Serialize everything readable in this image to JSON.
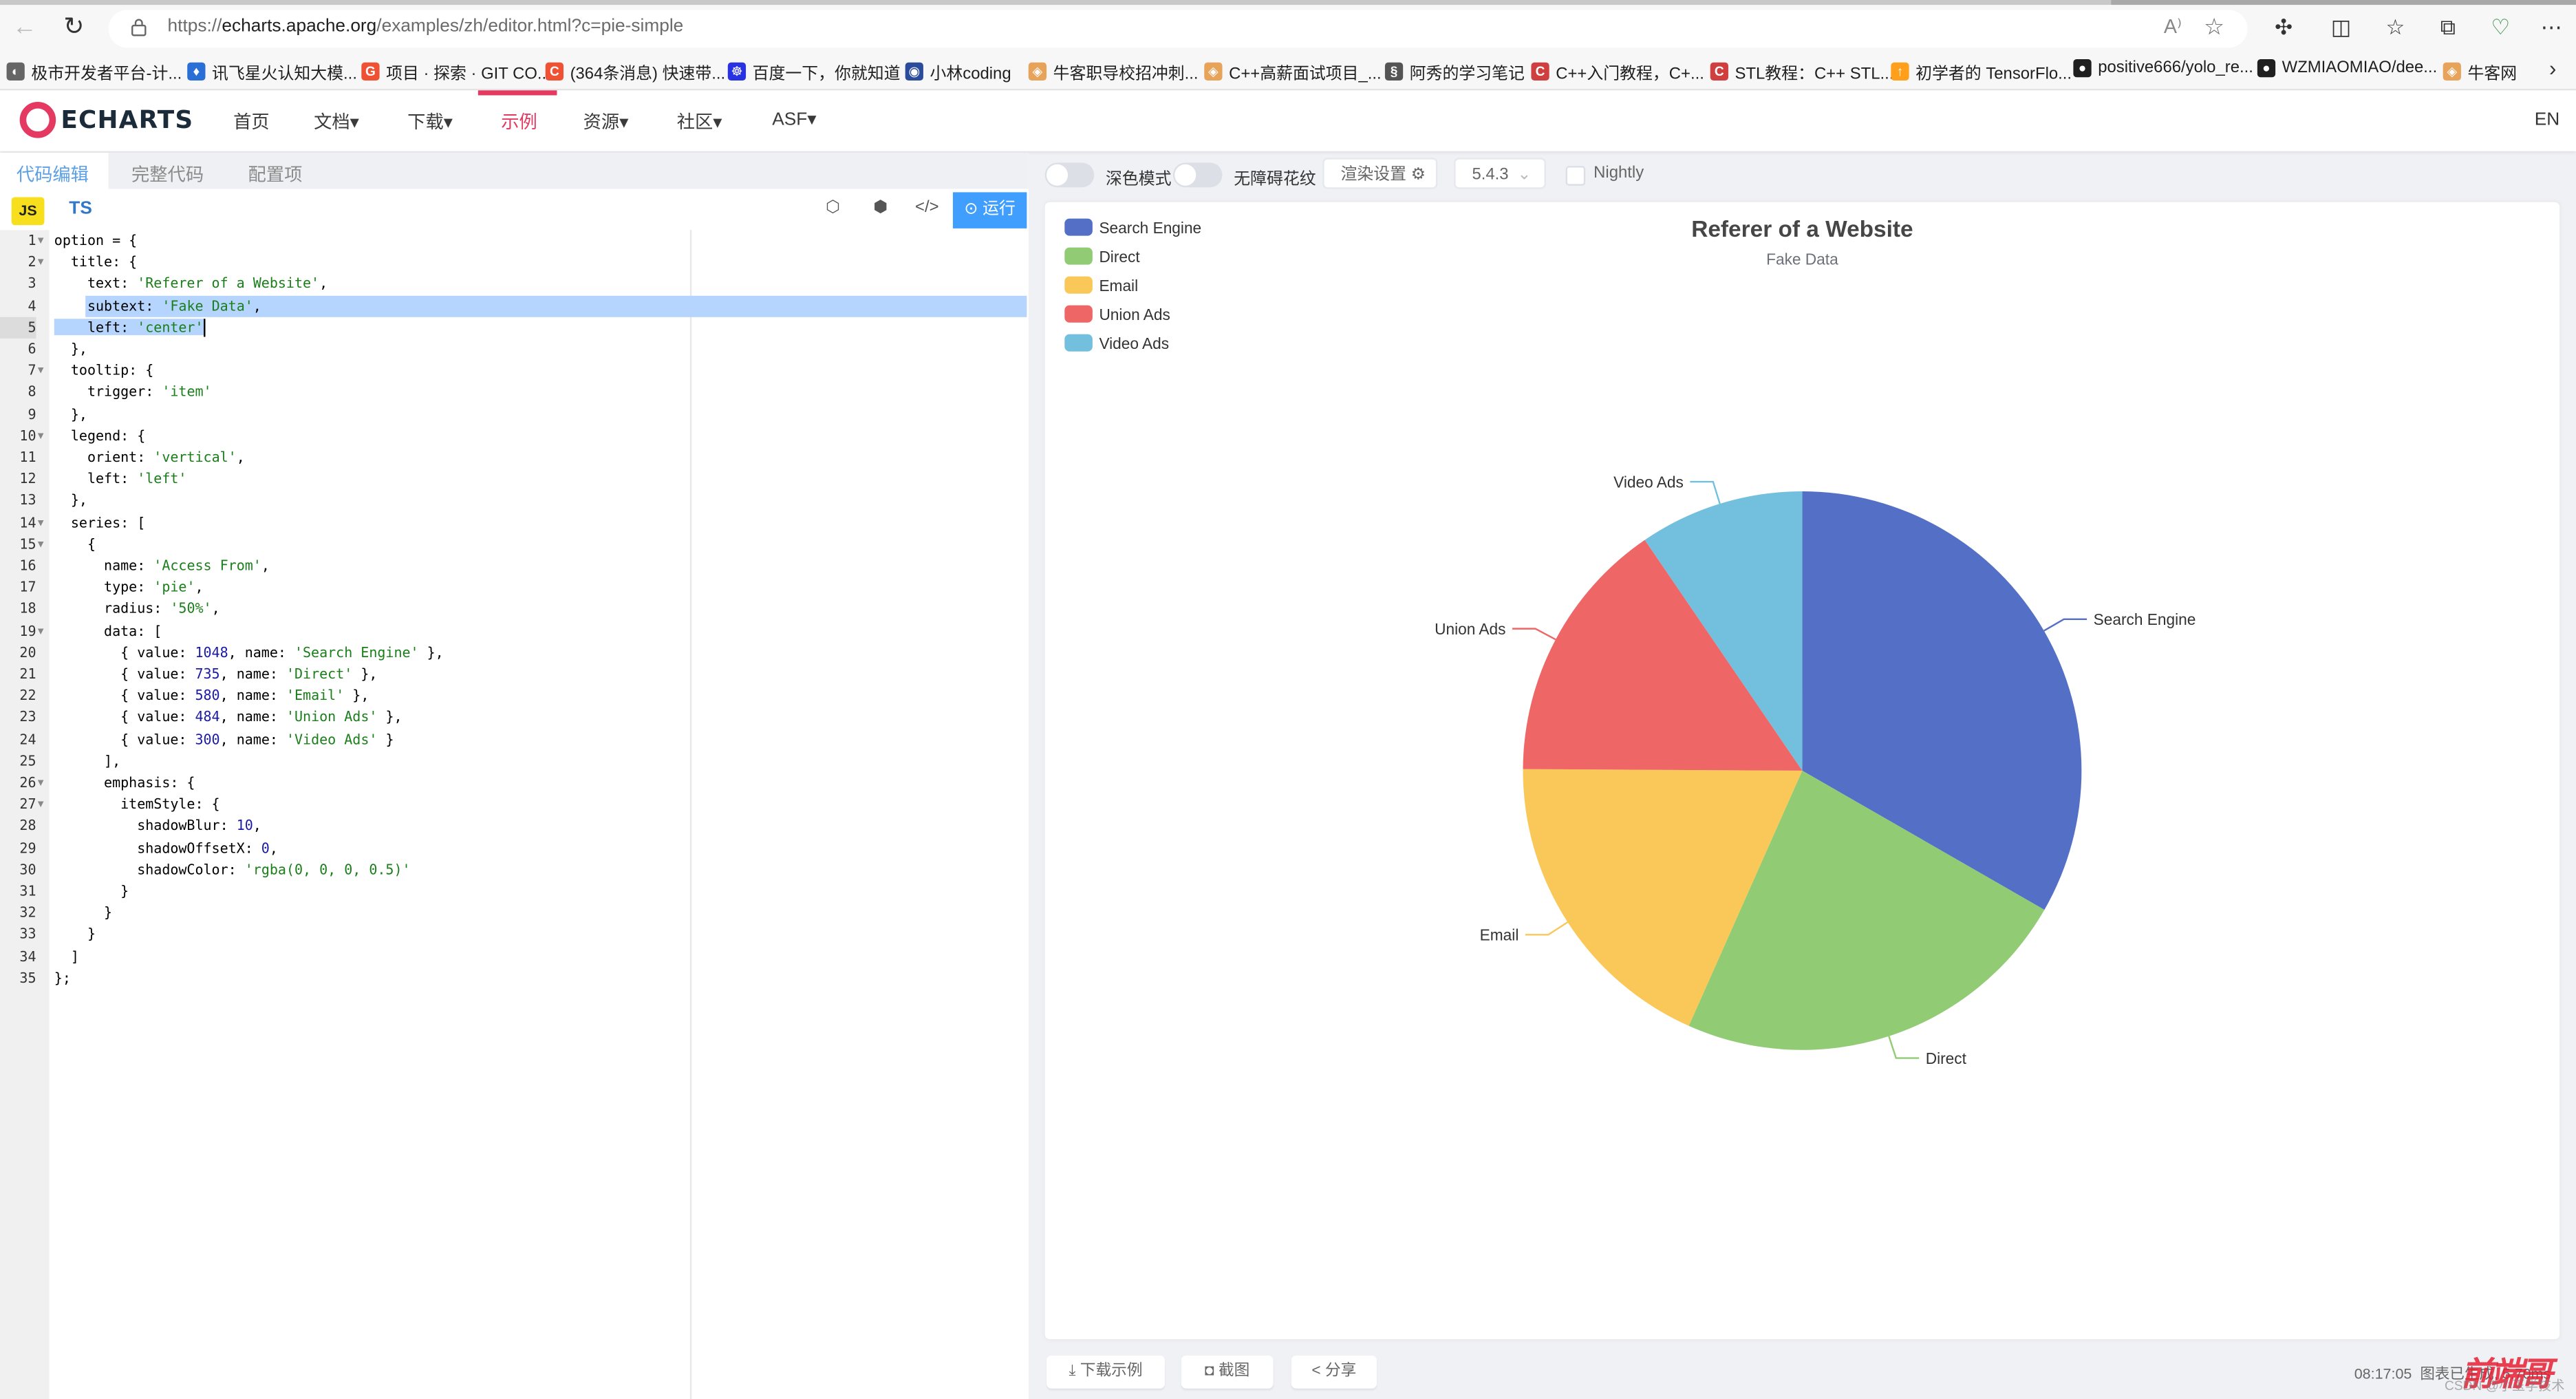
{
  "browser": {
    "url_prefix": "https://",
    "url_domain": "echarts.apache.org",
    "url_path": "/examples/zh/editor.html?c=pie-simple",
    "read_aloud_icon": "A⁾",
    "bookmarks": [
      {
        "label": "极市开发者平台-计...",
        "icon_color": "#666666",
        "icon_char": "◐"
      },
      {
        "label": "讯飞星火认知大模...",
        "icon_color": "#2a6fd6",
        "icon_char": "♦"
      },
      {
        "label": "项目 · 探索 · GIT CO...",
        "icon_color": "#f05133",
        "icon_char": "G"
      },
      {
        "label": "(364条消息) 快速带...",
        "icon_color": "#f05133",
        "icon_char": "C"
      },
      {
        "label": "百度一下，你就知道",
        "icon_color": "#2932e1",
        "icon_char": "☸"
      },
      {
        "label": "小林coding",
        "icon_color": "#2b4c9b",
        "icon_char": "◉"
      },
      {
        "label": "牛客职导校招冲刺...",
        "icon_color": "#e8a35a",
        "icon_char": "◈"
      },
      {
        "label": "C++高薪面试项目_...",
        "icon_color": "#e8a35a",
        "icon_char": "◈"
      },
      {
        "label": "阿秀的学习笔记",
        "icon_color": "#555555",
        "icon_char": "§"
      },
      {
        "label": "C++入门教程，C+...",
        "icon_color": "#d03f3f",
        "icon_char": "C"
      },
      {
        "label": "STL教程：C++ STL...",
        "icon_color": "#d03f3f",
        "icon_char": "C"
      },
      {
        "label": "初学者的 TensorFlo...",
        "icon_color": "#ff9f1c",
        "icon_char": "↑"
      },
      {
        "label": "positive666/yolo_re...",
        "icon_color": "#1f1f1f",
        "icon_char": "●"
      },
      {
        "label": "WZMIAOMIAO/dee...",
        "icon_color": "#1f1f1f",
        "icon_char": "●"
      },
      {
        "label": "牛客网",
        "icon_color": "#e8a35a",
        "icon_char": "◈"
      }
    ]
  },
  "site": {
    "logo_text": "ECHARTS",
    "menu": [
      {
        "label": "首页",
        "active": false
      },
      {
        "label": "文档▾",
        "active": false
      },
      {
        "label": "下载▾",
        "active": false
      },
      {
        "label": "示例",
        "active": true
      },
      {
        "label": "资源▾",
        "active": false
      },
      {
        "label": "社区▾",
        "active": false
      },
      {
        "label": "ASF▾",
        "active": false
      }
    ],
    "lang_switch": "EN"
  },
  "editor": {
    "tabs": [
      {
        "label": "代码编辑",
        "active": true
      },
      {
        "label": "完整代码",
        "active": false
      },
      {
        "label": "配置项",
        "active": false
      }
    ],
    "lang_js": "JS",
    "lang_ts": "TS",
    "run_label": "运行",
    "lines": [
      {
        "n": "1",
        "fold": true,
        "html": "option = {"
      },
      {
        "n": "2",
        "fold": true,
        "html": "  title: {"
      },
      {
        "n": "3",
        "fold": false,
        "html": "    text: <span class='s'>'Referer of a Website'</span>,"
      },
      {
        "n": "4",
        "fold": false,
        "html": "    <span class='sel'>subtext: <span class='s'>'Fake Data'</span>,</span>",
        "sel_full": true
      },
      {
        "n": "5",
        "fold": false,
        "html": "<span class='sel'>    left: <span class='s'>'center'</span></span><span class='cursor'></span>",
        "current": true
      },
      {
        "n": "6",
        "fold": false,
        "html": "  },"
      },
      {
        "n": "7",
        "fold": true,
        "html": "  tooltip: {"
      },
      {
        "n": "8",
        "fold": false,
        "html": "    trigger: <span class='s'>'item'</span>"
      },
      {
        "n": "9",
        "fold": false,
        "html": "  },"
      },
      {
        "n": "10",
        "fold": true,
        "html": "  legend: {"
      },
      {
        "n": "11",
        "fold": false,
        "html": "    orient: <span class='s'>'vertical'</span>,"
      },
      {
        "n": "12",
        "fold": false,
        "html": "    left: <span class='s'>'left'</span>"
      },
      {
        "n": "13",
        "fold": false,
        "html": "  },"
      },
      {
        "n": "14",
        "fold": true,
        "html": "  series: ["
      },
      {
        "n": "15",
        "fold": true,
        "html": "    {"
      },
      {
        "n": "16",
        "fold": false,
        "html": "      name: <span class='s'>'Access From'</span>,"
      },
      {
        "n": "17",
        "fold": false,
        "html": "      type: <span class='s'>'pie'</span>,"
      },
      {
        "n": "18",
        "fold": false,
        "html": "      radius: <span class='s'>'50%'</span>,"
      },
      {
        "n": "19",
        "fold": true,
        "html": "      data: ["
      },
      {
        "n": "20",
        "fold": false,
        "html": "        { value: <span class='n'>1048</span>, name: <span class='s'>'Search Engine'</span> },"
      },
      {
        "n": "21",
        "fold": false,
        "html": "        { value: <span class='n'>735</span>, name: <span class='s'>'Direct'</span> },"
      },
      {
        "n": "22",
        "fold": false,
        "html": "        { value: <span class='n'>580</span>, name: <span class='s'>'Email'</span> },"
      },
      {
        "n": "23",
        "fold": false,
        "html": "        { value: <span class='n'>484</span>, name: <span class='s'>'Union Ads'</span> },"
      },
      {
        "n": "24",
        "fold": false,
        "html": "        { value: <span class='n'>300</span>, name: <span class='s'>'Video Ads'</span> }"
      },
      {
        "n": "25",
        "fold": false,
        "html": "      ],"
      },
      {
        "n": "26",
        "fold": true,
        "html": "      emphasis: {"
      },
      {
        "n": "27",
        "fold": true,
        "html": "        itemStyle: {"
      },
      {
        "n": "28",
        "fold": false,
        "html": "          shadowBlur: <span class='n'>10</span>,"
      },
      {
        "n": "29",
        "fold": false,
        "html": "          shadowOffsetX: <span class='n'>0</span>,"
      },
      {
        "n": "30",
        "fold": false,
        "html": "          shadowColor: <span class='s'>'rgba(0, 0, 0, 0.5)'</span>"
      },
      {
        "n": "31",
        "fold": false,
        "html": "        }"
      },
      {
        "n": "32",
        "fold": false,
        "html": "      }"
      },
      {
        "n": "33",
        "fold": false,
        "html": "    }"
      },
      {
        "n": "34",
        "fold": false,
        "html": "  ]"
      },
      {
        "n": "35",
        "fold": false,
        "html": "};"
      }
    ]
  },
  "controls": {
    "dark_mode_label": "深色模式",
    "dark_mode_on": false,
    "aria_label": "无障碍花纹",
    "aria_on": false,
    "render_settings_label": "渲染设置 ⚙",
    "version_value": "5.4.3",
    "nightly_label": "Nightly",
    "nightly_checked": false
  },
  "footer": {
    "download_label": "⤓  下载示例",
    "screenshot_label": "◘  截图",
    "share_label": "<  分享",
    "status_time": "08:17:05",
    "status_text": "图表已生成, 5.70ms",
    "watermark": "前端哥",
    "watermark_sub": "CSDN @小玉学技术"
  },
  "chart_data": {
    "type": "pie",
    "title": "Referer of a Website",
    "subtitle": "Fake Data",
    "series_name": "Access From",
    "legend_placement": "left",
    "legend_orient": "vertical",
    "radius": "50%",
    "categories": [
      "Search Engine",
      "Direct",
      "Email",
      "Union Ads",
      "Video Ads"
    ],
    "values": [
      1048,
      735,
      580,
      484,
      300
    ],
    "colors": [
      "#5470c6",
      "#91cc75",
      "#fac858",
      "#ee6666",
      "#73c0de"
    ]
  }
}
